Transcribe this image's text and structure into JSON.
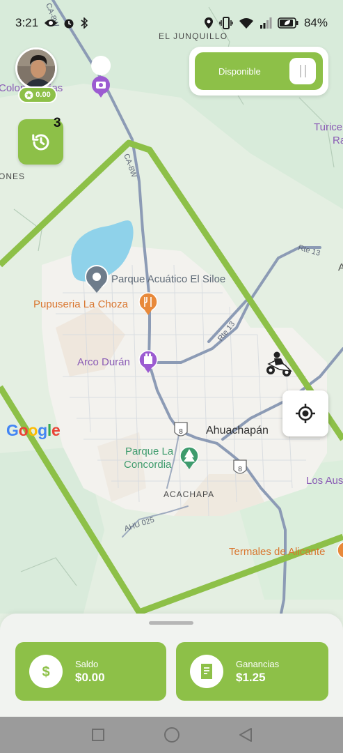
{
  "status_bar": {
    "time": "3:21",
    "battery": "84%",
    "left_icons": [
      "eye-icon",
      "alarm-icon",
      "bluetooth-icon"
    ],
    "right_icons": [
      "location-pin-icon",
      "vibrate-icon",
      "wifi-icon",
      "signal-icon",
      "battery-icon"
    ]
  },
  "driver": {
    "rating": "0.00",
    "history_count": "3"
  },
  "availability": {
    "label": "Disponible"
  },
  "map": {
    "places": {
      "junquillo": "EL JUNQUILLO",
      "colonia_vinas": "Colonia Viñas",
      "turicentro": "Turice",
      "turicentro_2": "Ra",
      "ones": "ONES",
      "siloe": "Parque Acuático El Siloe",
      "pupuseria": "Pupuseria La Choza",
      "arco": "Arco Durán",
      "ahuachapan": "Ahuachapán",
      "parque_concordia_1": "Parque La",
      "parque_concordia_2": "Concordia",
      "acachapa": "ACACHAPA",
      "los_aus": "Los Aus",
      "termales": "Termales de Alicante",
      "east_a": "A"
    },
    "roads": {
      "ca8w": "CA-8W",
      "rte13_top": "Rte 13",
      "rte13_mid": "Rte 13",
      "ahu025": "AHU 025",
      "shield_8_a": "8",
      "shield_8_b": "8"
    },
    "google_logo": "Google",
    "colors": {
      "zone_stroke": "#8dc048",
      "water": "#8fd2ea",
      "road": "#8c9bb5"
    }
  },
  "bottom": {
    "saldo": {
      "label": "Saldo",
      "value": "$0.00",
      "icon": "dollar-icon"
    },
    "ganancias": {
      "label": "Ganancias",
      "value": "$1.25",
      "icon": "receipt-icon"
    }
  },
  "theme": {
    "accent": "#8dc048"
  }
}
